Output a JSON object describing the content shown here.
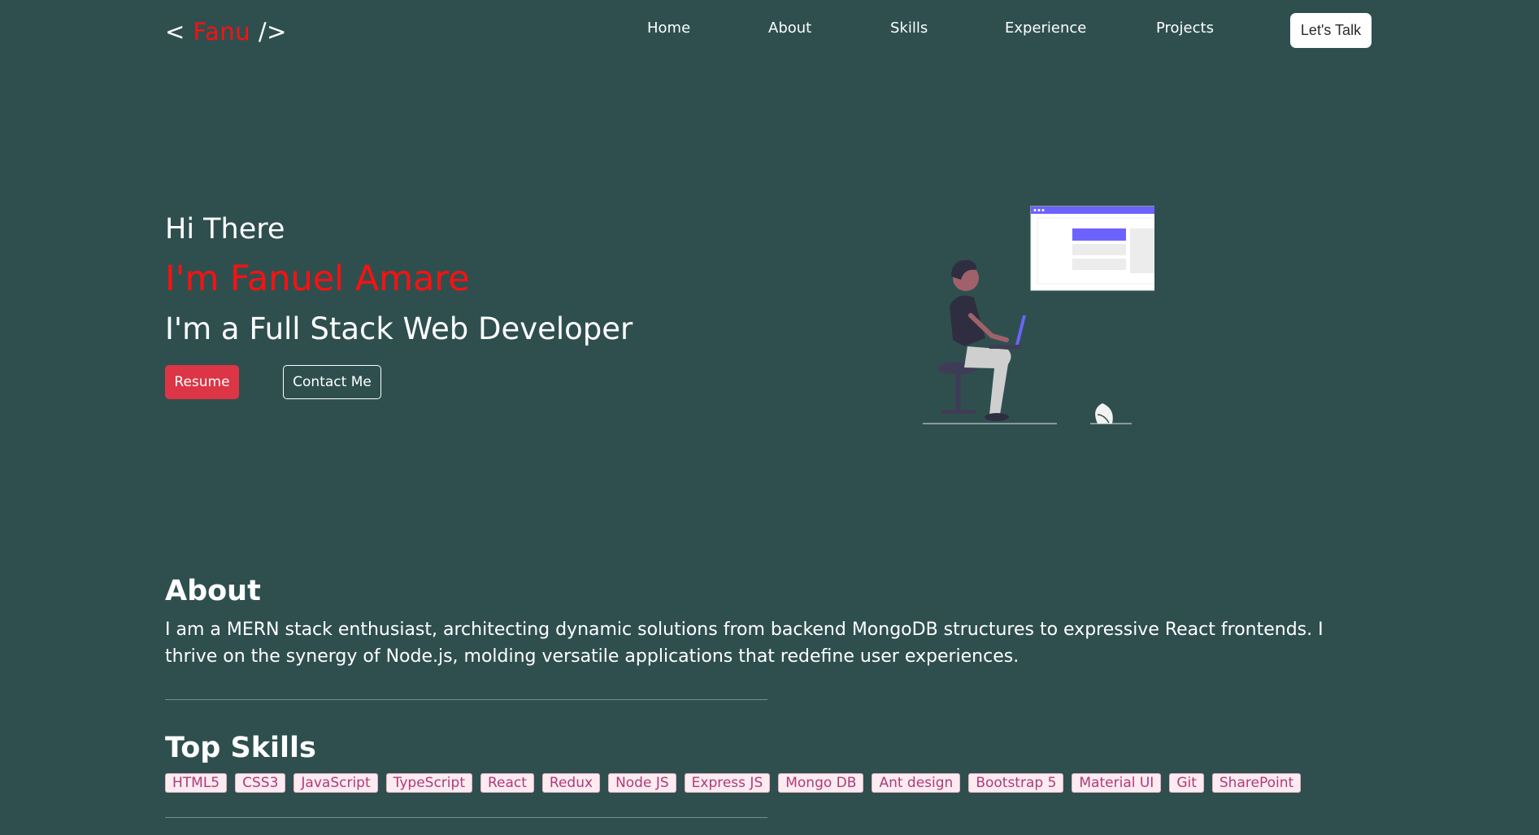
{
  "brand": {
    "open": "<",
    "name": "Fanu",
    "close": "/>"
  },
  "nav": {
    "links": [
      {
        "label": "Home"
      },
      {
        "label": "About"
      },
      {
        "label": "Skills"
      },
      {
        "label": "Experience"
      },
      {
        "label": "Projects"
      }
    ],
    "cta": "Let's Talk"
  },
  "hero": {
    "greeting": "Hi There",
    "name": "I'm Fanuel Amare",
    "role": "I'm a Full Stack Web Developer",
    "resume_label": "Resume",
    "contact_label": "Contact Me",
    "illustration": "person-on-laptop-illustration"
  },
  "about": {
    "title": "About",
    "text": "I am a MERN stack enthusiast, architecting dynamic solutions from backend MongoDB structures to expressive React frontends. I thrive on the synergy of Node.js, molding versatile applications that redefine user experiences."
  },
  "skills": {
    "title": "Top Skills",
    "items": [
      "HTML5",
      "CSS3",
      "JavaScript",
      "TypeScript",
      "React",
      "Redux",
      "Node JS",
      "Express JS",
      "Mongo DB",
      "Ant design",
      "Bootstrap 5",
      "Material UI",
      "Git",
      "SharePoint"
    ]
  },
  "colors": {
    "background": "#2f4f4f",
    "accent_red": "#ff1010",
    "resume_button": "#dc3545",
    "skill_text": "#b03a79",
    "skill_bg": "#fcebf1"
  }
}
